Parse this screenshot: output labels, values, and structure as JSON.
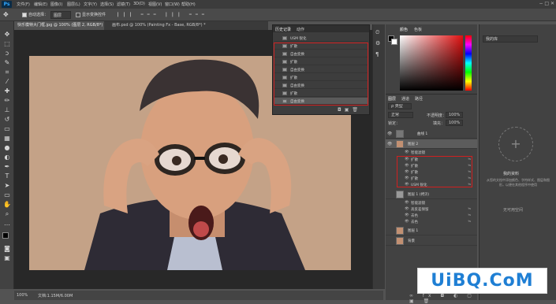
{
  "app": {
    "logo": "Ps",
    "menus": [
      "文件(F)",
      "编辑(E)",
      "图像(I)",
      "图层(L)",
      "文字(Y)",
      "选择(S)",
      "滤镜(T)",
      "3D(D)",
      "视图(V)",
      "窗口(W)",
      "帮助(H)"
    ],
    "window_controls": "−  □  ✕"
  },
  "options": {
    "auto_select": "自动选择：",
    "target": "图层",
    "transform": "显示变换控件"
  },
  "tabs": [
    "快乐模特大门框.jpg @ 100% (图层 2, RGB/8*) *",
    "画布.psd @ 100% (Painting Fx - Base, RGB/8*) *"
  ],
  "history": {
    "tabs": [
      "历史记录",
      "动作"
    ],
    "items": [
      "USM 锐化",
      "扩散",
      "自由变换",
      "扩散",
      "自由变换",
      "扩散",
      "自由变换",
      "扩散",
      "自由变换"
    ]
  },
  "color": {
    "tabs": [
      "颜色",
      "色板"
    ]
  },
  "layers": {
    "tabs": [
      "图层",
      "通道",
      "路径"
    ],
    "kind": "ρ 类型",
    "mode": "正常",
    "opacity_label": "不透明度：",
    "opacity": "100%",
    "lock_label": "锁定：",
    "fill_label": "填充：",
    "fill": "100%",
    "rows": [
      {
        "name": "曲线 1",
        "type": "adj"
      },
      {
        "name": "图层 2",
        "type": "layer"
      },
      {
        "name": "智能滤镜",
        "type": "smart"
      },
      {
        "name": "扩散",
        "type": "fx"
      },
      {
        "name": "扩散",
        "type": "fx"
      },
      {
        "name": "扩散",
        "type": "fx"
      },
      {
        "name": "扩散",
        "type": "fx"
      },
      {
        "name": "USM 锐化",
        "type": "fx"
      },
      {
        "name": "图层 1 (拷贝)",
        "type": "layer"
      },
      {
        "name": "智能滤镜",
        "type": "smart"
      },
      {
        "name": "高反差保留",
        "type": "fx"
      },
      {
        "name": "去色",
        "type": "fx"
      },
      {
        "name": "去色",
        "type": "fx"
      },
      {
        "name": "图层 1",
        "type": "layer"
      },
      {
        "name": "背景",
        "type": "layer"
      }
    ]
  },
  "libraries": {
    "title": "我的库",
    "heading": "我的资料",
    "desc": "从您的文档中添加颜色、字符样式、图层和图形，以便在其他程序中使用",
    "size": "无可用空间"
  },
  "status": {
    "zoom": "100%",
    "doc": "文档:1.15M/6.00M"
  },
  "watermark": "UiBQ.CoM",
  "colors": {
    "accent_red": "#d02020",
    "watermark_blue": "#1f7fd4"
  }
}
